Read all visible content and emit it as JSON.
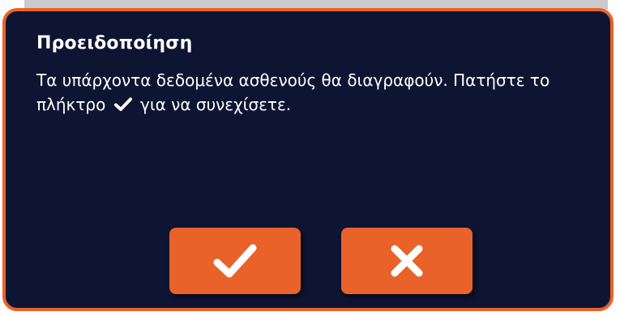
{
  "dialog": {
    "title": "Προειδοποίηση",
    "message_part1": "Τα υπάρχοντα δεδομένα ασθενούς θα διαγραφούν. Πατήστε το πλήκτρο",
    "message_icon": "checkmark-icon",
    "message_part2": "για να συνεχίσετε."
  },
  "buttons": {
    "confirm": {
      "icon": "checkmark-icon"
    },
    "cancel": {
      "icon": "x-icon"
    }
  },
  "colors": {
    "background": "#0e1533",
    "accent": "#e8622a",
    "text": "#ffffff"
  }
}
